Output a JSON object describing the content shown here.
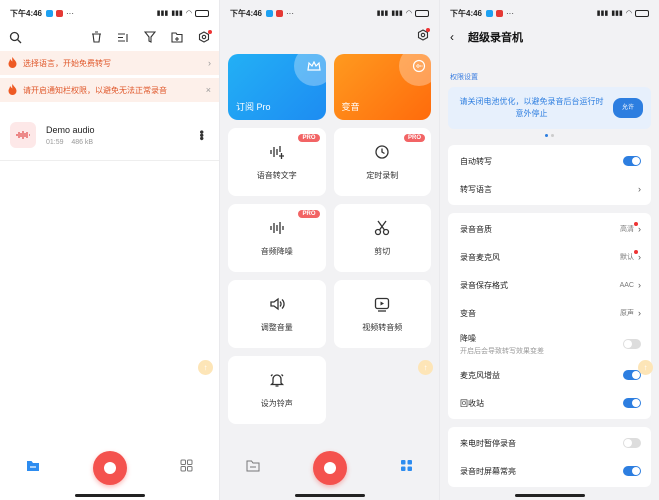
{
  "status": {
    "time": "下午4:46",
    "dots": "···"
  },
  "home": {
    "notices": [
      {
        "text": "选择语言，开始免费转写",
        "end": "›"
      },
      {
        "text": "请开启通知栏权限，以避免无法正常录音",
        "end": "×"
      }
    ],
    "file": {
      "name": "Demo audio",
      "duration": "01:59",
      "size": "486 kB"
    }
  },
  "tools": {
    "subscribe_label": "订阅 Pro",
    "voice_change_label": "变音",
    "pro_badge": "PRO",
    "items": [
      {
        "label": "语音转文字",
        "icon": "speech-to-text-icon",
        "pro": true
      },
      {
        "label": "定时录制",
        "icon": "clock-icon",
        "pro": true
      },
      {
        "label": "音频降噪",
        "icon": "waveform-icon",
        "pro": true
      },
      {
        "label": "剪切",
        "icon": "scissors-icon",
        "pro": false
      },
      {
        "label": "调整音量",
        "icon": "volume-icon",
        "pro": false
      },
      {
        "label": "视频转音频",
        "icon": "video-to-audio-icon",
        "pro": false
      },
      {
        "label": "设为铃声",
        "icon": "bell-icon",
        "pro": false
      }
    ]
  },
  "settings": {
    "title": "超级录音机",
    "section_label": "权限设置",
    "banner_text": "请关闭电池优化，以避免录音后台运行时意外停止",
    "banner_button": "允许",
    "rows": {
      "auto_transcribe": "自动转写",
      "transcribe_language": "转写语言",
      "quality": "录音音质",
      "quality_value": "高清",
      "mic": "录音麦克风",
      "mic_value": "默认",
      "format": "录音保存格式",
      "format_value": "AAC",
      "voice_change": "变音",
      "voice_change_value": "原声",
      "denoise": "降噪",
      "denoise_sub": "开启后会导致转写效果变差",
      "mic_gain": "麦克风增益",
      "recycle_bin": "回收站",
      "pause_on_call": "来电时暂停录音",
      "screen_on": "录音时屏幕常亮"
    },
    "toggles": {
      "auto_transcribe": true,
      "denoise": false,
      "mic_gain": true,
      "recycle_bin": true,
      "pause_on_call": false,
      "screen_on": true
    }
  },
  "colors": {
    "accent": "#2d7ee0",
    "record": "#f4524e",
    "notice": "#e0572a",
    "pro": "#f26465"
  }
}
